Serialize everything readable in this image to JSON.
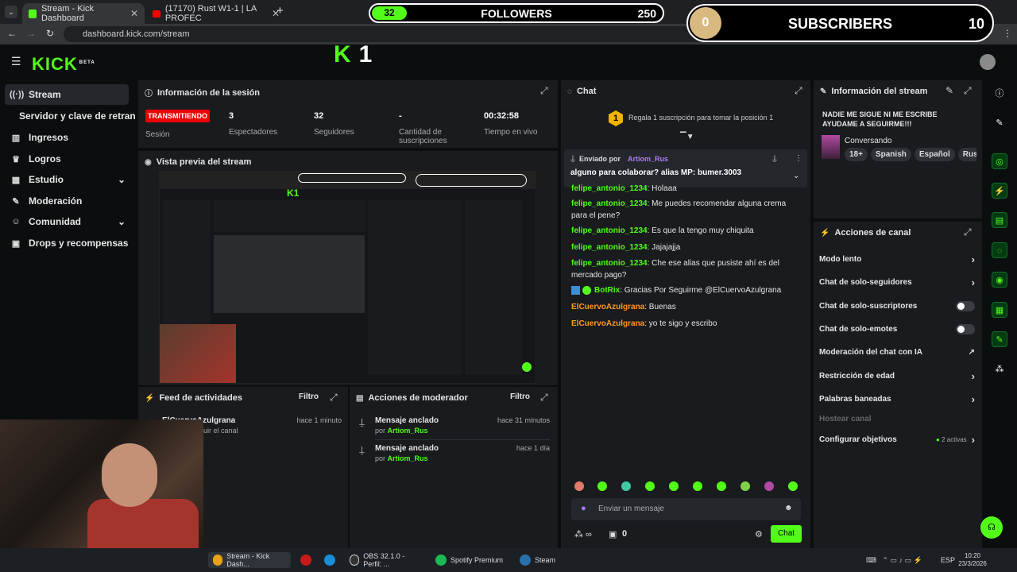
{
  "browser": {
    "tabs": [
      {
        "title": "Stream - Kick Dashboard"
      },
      {
        "title": "(17170) Rust W1-1 | LA PROFEC"
      }
    ],
    "new_tab": "+",
    "url": "dashboard.kick.com/stream"
  },
  "overlay": {
    "followers_current": "32",
    "followers_label": "FOLLOWERS",
    "followers_goal": "250",
    "subs_current": "0",
    "subs_label": "SUBSCRIBERS",
    "subs_goal": "10",
    "big_logo_number": "1"
  },
  "header": {
    "logo": "KICK",
    "logo_sup": "BETA"
  },
  "sidebar": {
    "items": [
      {
        "label": "Stream",
        "icon": "broadcast-icon"
      },
      {
        "label": "Servidor y clave de retransm"
      },
      {
        "label": "Ingresos",
        "icon": "chart-icon"
      },
      {
        "label": "Logros",
        "icon": "trophy-icon"
      },
      {
        "label": "Estudio",
        "icon": "grid-icon"
      },
      {
        "label": "Moderación",
        "icon": "wrench-icon"
      },
      {
        "label": "Comunidad",
        "icon": "people-icon"
      },
      {
        "label": "Drops y recompensas",
        "icon": "gift-icon"
      }
    ]
  },
  "session": {
    "title": "Información de la sesión",
    "status": "TRANSMITIENDO",
    "status_label": "Sesión",
    "viewers": "3",
    "viewers_label": "Espectadores",
    "followers": "32",
    "followers_label": "Seguidores",
    "subs": "-",
    "subs_label": "Cantidad de suscripciones",
    "uptime": "00:32:58",
    "uptime_label": "Tiempo en vivo"
  },
  "preview": {
    "title": "Vista previa del stream"
  },
  "feed": {
    "title": "Feed de actividades",
    "filter": "Filtro",
    "item_user": "ElCuervoAzulgrana",
    "item_text": "uir el canal",
    "item_time": "hace 1 minuto"
  },
  "mod": {
    "title": "Acciones de moderador",
    "filter": "Filtro",
    "rows": [
      {
        "action": "Mensaje anclado",
        "by": "por",
        "user": "Artiom_Rus",
        "time": "hace 31 minutos"
      },
      {
        "action": "Mensaje anclado",
        "by": "por",
        "user": "Artiom_Rus",
        "time": "hace 1 día"
      }
    ]
  },
  "chat": {
    "title": "Chat",
    "gift_rank": "1",
    "gift_text": "Regala 1 suscripción para tomar la posición 1",
    "pinned_by": "Enviado por",
    "pinned_user": "Artiom_Rus",
    "pinned_text": "alguno para colaborar? alias MP: bumer.3003",
    "messages": [
      {
        "user": "felipe_antonio_1234",
        "text": ": Holaaa"
      },
      {
        "user": "felipe_antonio_1234",
        "text": ": Me puedes recomendar alguna crema para el pene?"
      },
      {
        "user": "felipe_antonio_1234",
        "text": ": Es que la tengo muy chiquita"
      },
      {
        "user": "felipe_antonio_1234",
        "text": ": Jajajajja"
      },
      {
        "user": "felipe_antonio_1234",
        "text": ": Che ese alias que pusiste ahí es del mercado pago?"
      },
      {
        "user": "BotRix",
        "text": ": Gracias Por Seguirme @ElCuervoAzulgrana"
      },
      {
        "user": "ElCuervoAzulgrana",
        "text": ": Buenas"
      },
      {
        "user": "ElCuervoAzulgrana",
        "text": ": yo te sigo y escribo"
      }
    ],
    "input_placeholder": "Enviar un mensaje",
    "points": "0",
    "send": "Chat"
  },
  "stream_info": {
    "title": "Información del stream",
    "stream_title": "NADIE ME SIGUE NI ME ESCRIBE AYUDAME A SEGUIRME!!!",
    "category": "Conversando",
    "tags": [
      "18+",
      "Spanish",
      "Español",
      "Russ"
    ]
  },
  "channel_actions": {
    "title": "Acciones de canal",
    "items": [
      {
        "label": "Modo lento",
        "type": "arrow"
      },
      {
        "label": "Chat de solo-seguidores",
        "type": "arrow"
      },
      {
        "label": "Chat de solo-suscriptores",
        "type": "toggle"
      },
      {
        "label": "Chat de solo-emotes",
        "type": "toggle"
      },
      {
        "label": "Moderación del chat con IA",
        "type": "external"
      },
      {
        "label": "Restricción de edad",
        "type": "arrow"
      },
      {
        "label": "Palabras baneadas",
        "type": "arrow"
      },
      {
        "label": "Hostear canal",
        "type": "disabled"
      },
      {
        "label": "Configurar objetivos",
        "type": "arrow",
        "extra": "2 activas"
      }
    ]
  },
  "taskbar": {
    "items": [
      "Stream - Kick Dash...",
      "OBS 32.1.0 - Perfil: ...",
      "Spotify Premium",
      "Steam"
    ],
    "lang": "ESP",
    "time": "10:20",
    "date": "23/3/2026"
  },
  "colors": {
    "accent": "#53fc18",
    "live": "#eb0400",
    "panel": "#191b1f"
  }
}
